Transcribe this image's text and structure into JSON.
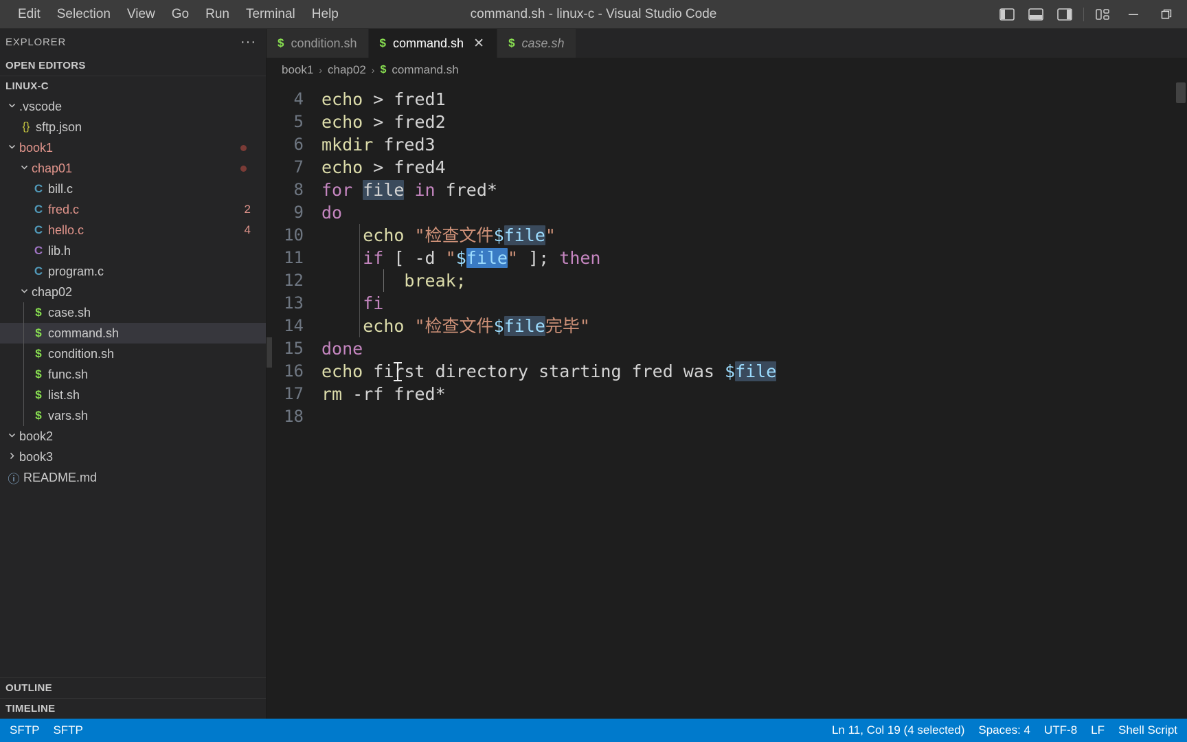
{
  "window": {
    "title": "command.sh - linux-c - Visual Studio Code",
    "menus": [
      "Edit",
      "Selection",
      "View",
      "Go",
      "Run",
      "Terminal",
      "Help"
    ],
    "controls": {
      "toggle_primary_sidebar": "toggle-primary-sidebar-icon",
      "toggle_panel": "toggle-panel-icon",
      "toggle_secondary_sidebar": "toggle-secondary-sidebar-icon",
      "customize_layout": "customize-layout-icon",
      "minimize": "minimize-icon",
      "maximize": "maximize-icon"
    }
  },
  "sidebar": {
    "title": "EXPLORER",
    "more_actions": "···",
    "open_editors_label": "OPEN EDITORS",
    "workspace_label": "LINUX-C",
    "outline_label": "OUTLINE",
    "timeline_label": "TIMELINE",
    "tree": [
      {
        "label": ".vscode",
        "kind": "folder",
        "depth": 0,
        "expanded": true,
        "icon": "chevron-down-icon",
        "modified": false,
        "badge": ""
      },
      {
        "label": "sftp.json",
        "kind": "file",
        "depth": 1,
        "icon": "json-file-icon",
        "glyph": "{}",
        "modified": false,
        "badge": ""
      },
      {
        "label": "book1",
        "kind": "folder",
        "depth": 0,
        "expanded": true,
        "icon": "chevron-down-icon",
        "modified": true,
        "badge": "dot"
      },
      {
        "label": "chap01",
        "kind": "folder",
        "depth": 1,
        "expanded": true,
        "icon": "chevron-down-icon",
        "modified": true,
        "badge": "dot"
      },
      {
        "label": "bill.c",
        "kind": "file",
        "depth": 2,
        "icon": "c-file-icon",
        "glyph": "C",
        "modified": false,
        "badge": ""
      },
      {
        "label": "fred.c",
        "kind": "file",
        "depth": 2,
        "icon": "c-file-icon",
        "glyph": "C",
        "modified": true,
        "badge": "2"
      },
      {
        "label": "hello.c",
        "kind": "file",
        "depth": 2,
        "icon": "c-file-icon",
        "glyph": "C",
        "modified": true,
        "badge": "4"
      },
      {
        "label": "lib.h",
        "kind": "file",
        "depth": 2,
        "icon": "h-file-icon",
        "glyph": "C",
        "modified": false,
        "badge": ""
      },
      {
        "label": "program.c",
        "kind": "file",
        "depth": 2,
        "icon": "c-file-icon",
        "glyph": "C",
        "modified": false,
        "badge": ""
      },
      {
        "label": "chap02",
        "kind": "folder",
        "depth": 1,
        "expanded": true,
        "icon": "chevron-down-icon",
        "modified": false,
        "badge": ""
      },
      {
        "label": "case.sh",
        "kind": "file",
        "depth": 2,
        "icon": "shell-file-icon",
        "glyph": "$",
        "modified": false,
        "badge": ""
      },
      {
        "label": "command.sh",
        "kind": "file",
        "depth": 2,
        "icon": "shell-file-icon",
        "glyph": "$",
        "modified": false,
        "badge": "",
        "selected": true
      },
      {
        "label": "condition.sh",
        "kind": "file",
        "depth": 2,
        "icon": "shell-file-icon",
        "glyph": "$",
        "modified": false,
        "badge": ""
      },
      {
        "label": "func.sh",
        "kind": "file",
        "depth": 2,
        "icon": "shell-file-icon",
        "glyph": "$",
        "modified": false,
        "badge": ""
      },
      {
        "label": "list.sh",
        "kind": "file",
        "depth": 2,
        "icon": "shell-file-icon",
        "glyph": "$",
        "modified": false,
        "badge": ""
      },
      {
        "label": "vars.sh",
        "kind": "file",
        "depth": 2,
        "icon": "shell-file-icon",
        "glyph": "$",
        "modified": false,
        "badge": ""
      },
      {
        "label": "book2",
        "kind": "folder",
        "depth": 0,
        "expanded": true,
        "icon": "chevron-down-icon",
        "modified": false,
        "badge": ""
      },
      {
        "label": "book3",
        "kind": "folder",
        "depth": 0,
        "expanded": false,
        "icon": "chevron-right-icon",
        "modified": false,
        "badge": ""
      },
      {
        "label": "README.md",
        "kind": "file",
        "depth": 0,
        "icon": "markdown-file-icon",
        "glyph": "ⓘ",
        "modified": false,
        "badge": ""
      }
    ]
  },
  "tabs": [
    {
      "label": "condition.sh",
      "icon": "shell-file-icon",
      "glyph": "$",
      "active": false,
      "preview": false,
      "closable": false
    },
    {
      "label": "command.sh",
      "icon": "shell-file-icon",
      "glyph": "$",
      "active": true,
      "preview": false,
      "closable": true
    },
    {
      "label": "case.sh",
      "icon": "shell-file-icon",
      "glyph": "$",
      "active": false,
      "preview": true,
      "closable": false
    }
  ],
  "breadcrumb": {
    "items": [
      "book1",
      "chap02",
      "command.sh"
    ],
    "separator": "›",
    "file_glyph": "$"
  },
  "editor": {
    "first_visible_line": 4,
    "lines": [
      {
        "n": 4,
        "tokens": [
          {
            "t": "echo",
            "c": "fn"
          },
          {
            "t": " > ",
            "c": "plain"
          },
          {
            "t": "fred1",
            "c": "plain"
          }
        ]
      },
      {
        "n": 5,
        "tokens": [
          {
            "t": "echo",
            "c": "fn"
          },
          {
            "t": " > ",
            "c": "plain"
          },
          {
            "t": "fred2",
            "c": "plain"
          }
        ]
      },
      {
        "n": 6,
        "tokens": [
          {
            "t": "mkdir",
            "c": "fn"
          },
          {
            "t": " fred3",
            "c": "plain"
          }
        ]
      },
      {
        "n": 7,
        "tokens": [
          {
            "t": "echo",
            "c": "fn"
          },
          {
            "t": " > ",
            "c": "plain"
          },
          {
            "t": "fred4",
            "c": "plain"
          }
        ]
      },
      {
        "n": 8,
        "tokens": [
          {
            "t": "for ",
            "c": "kw"
          },
          {
            "t": "file",
            "c": "plain",
            "hl": "match"
          },
          {
            "t": " ",
            "c": "plain"
          },
          {
            "t": "in",
            "c": "kw"
          },
          {
            "t": " fred*",
            "c": "plain"
          }
        ]
      },
      {
        "n": 9,
        "tokens": [
          {
            "t": "do",
            "c": "kw"
          }
        ]
      },
      {
        "n": 10,
        "tokens": [
          {
            "t": "    ",
            "c": "plain"
          },
          {
            "t": "echo",
            "c": "fn"
          },
          {
            "t": " ",
            "c": "plain"
          },
          {
            "t": "\"检查文件",
            "c": "str"
          },
          {
            "t": "$",
            "c": "var"
          },
          {
            "t": "file",
            "c": "var",
            "hl": "match"
          },
          {
            "t": "\"",
            "c": "str"
          }
        ]
      },
      {
        "n": 11,
        "tokens": [
          {
            "t": "    ",
            "c": "plain"
          },
          {
            "t": "if",
            "c": "kw"
          },
          {
            "t": " [ -d ",
            "c": "plain"
          },
          {
            "t": "\"",
            "c": "str"
          },
          {
            "t": "$",
            "c": "var"
          },
          {
            "t": "file",
            "c": "var",
            "hl": "active"
          },
          {
            "t": "\"",
            "c": "str"
          },
          {
            "t": " ]; ",
            "c": "plain"
          },
          {
            "t": "then",
            "c": "kw"
          }
        ]
      },
      {
        "n": 12,
        "tokens": [
          {
            "t": "        ",
            "c": "plain"
          },
          {
            "t": "break;",
            "c": "fn"
          }
        ]
      },
      {
        "n": 13,
        "tokens": [
          {
            "t": "    ",
            "c": "plain"
          },
          {
            "t": "fi",
            "c": "kw"
          }
        ]
      },
      {
        "n": 14,
        "tokens": [
          {
            "t": "    ",
            "c": "plain"
          },
          {
            "t": "echo",
            "c": "fn"
          },
          {
            "t": " ",
            "c": "plain"
          },
          {
            "t": "\"检查文件",
            "c": "str"
          },
          {
            "t": "$",
            "c": "var"
          },
          {
            "t": "file",
            "c": "var",
            "hl": "match"
          },
          {
            "t": "完毕\"",
            "c": "str"
          }
        ]
      },
      {
        "n": 15,
        "tokens": [
          {
            "t": "done",
            "c": "kw"
          }
        ]
      },
      {
        "n": 16,
        "tokens": [
          {
            "t": "echo",
            "c": "fn"
          },
          {
            "t": " first directory starting fred was ",
            "c": "plain"
          },
          {
            "t": "$",
            "c": "var"
          },
          {
            "t": "file",
            "c": "var",
            "hl": "match"
          }
        ]
      },
      {
        "n": 17,
        "tokens": [
          {
            "t": "rm",
            "c": "fn"
          },
          {
            "t": " -rf fred*",
            "c": "plain"
          }
        ]
      },
      {
        "n": 18,
        "tokens": []
      }
    ]
  },
  "statusbar": {
    "left": [
      "SFTP",
      "SFTP"
    ],
    "right": [
      "Ln 11, Col 19 (4 selected)",
      "Spaces: 4",
      "UTF-8",
      "LF",
      "Shell Script"
    ],
    "background": "#007acc"
  },
  "colors": {
    "titlebar_bg": "#3c3c3c",
    "sidebar_bg": "#252526",
    "editor_bg": "#1e1e1e",
    "tab_active_bg": "#1e1e1e",
    "tab_inactive_bg": "#2d2d2d",
    "selected_row_bg": "#37373d",
    "modified_text": "#e2958c",
    "shell_icon": "#89e051",
    "keyword": "#c586c0",
    "function": "#dcdcaa",
    "string": "#ce9178",
    "variable": "#9cdcfe",
    "selection_match": "#3a4a5c",
    "selection_active": "#3a7bc4",
    "status_bg": "#007acc"
  }
}
